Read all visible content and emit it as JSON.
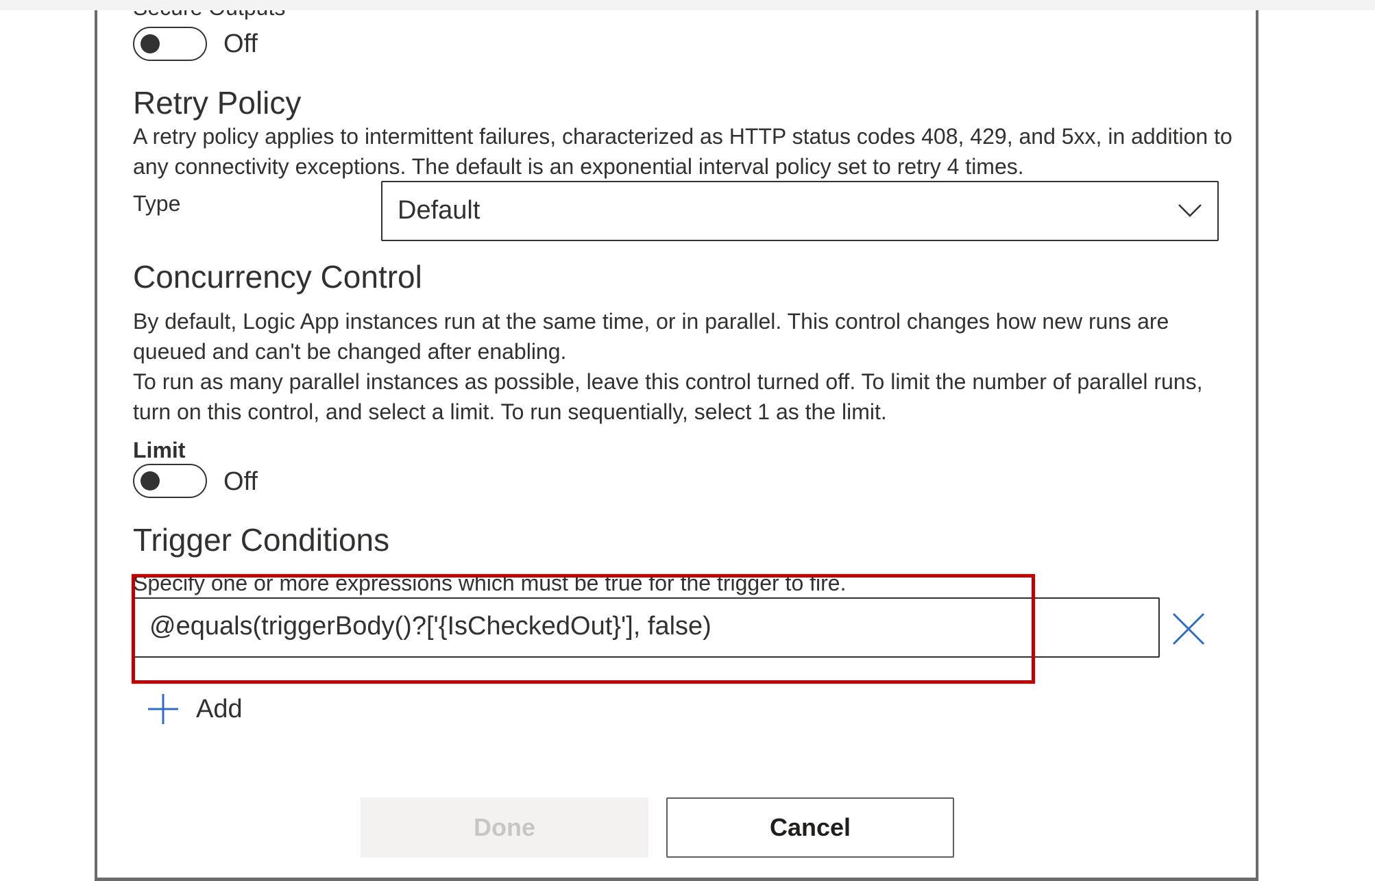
{
  "secure_outputs": {
    "label_partial": "Secure Outputs",
    "toggle_state": "Off"
  },
  "retry_policy": {
    "title": "Retry Policy",
    "description": "A retry policy applies to intermittent failures, characterized as HTTP status codes 408, 429, and 5xx, in addition to any connectivity exceptions. The default is an exponential interval policy set to retry 4 times.",
    "type_label": "Type",
    "type_value": "Default"
  },
  "concurrency_control": {
    "title": "Concurrency Control",
    "description_1": "By default, Logic App instances run at the same time, or in parallel. This control changes how new runs are queued and can't be changed after enabling.",
    "description_2": "To run as many parallel instances as possible, leave this control turned off. To limit the number of parallel runs, turn on this control, and select a limit. To run sequentially, select 1 as the limit.",
    "limit_label": "Limit",
    "toggle_state": "Off"
  },
  "trigger_conditions": {
    "title": "Trigger Conditions",
    "description": "Specify one or more expressions which must be true for the trigger to fire.",
    "conditions": [
      "@equals(triggerBody()?['{IsCheckedOut}'], false)"
    ],
    "add_label": "Add"
  },
  "footer": {
    "done_label": "Done",
    "cancel_label": "Cancel"
  },
  "colors": {
    "highlight": "#c00000",
    "icon_blue": "#2f6cc9",
    "disabled_text": "#c8c6c4"
  },
  "icons": {
    "dropdown": "chevron-down-icon",
    "remove": "close-icon",
    "add": "plus-icon"
  }
}
